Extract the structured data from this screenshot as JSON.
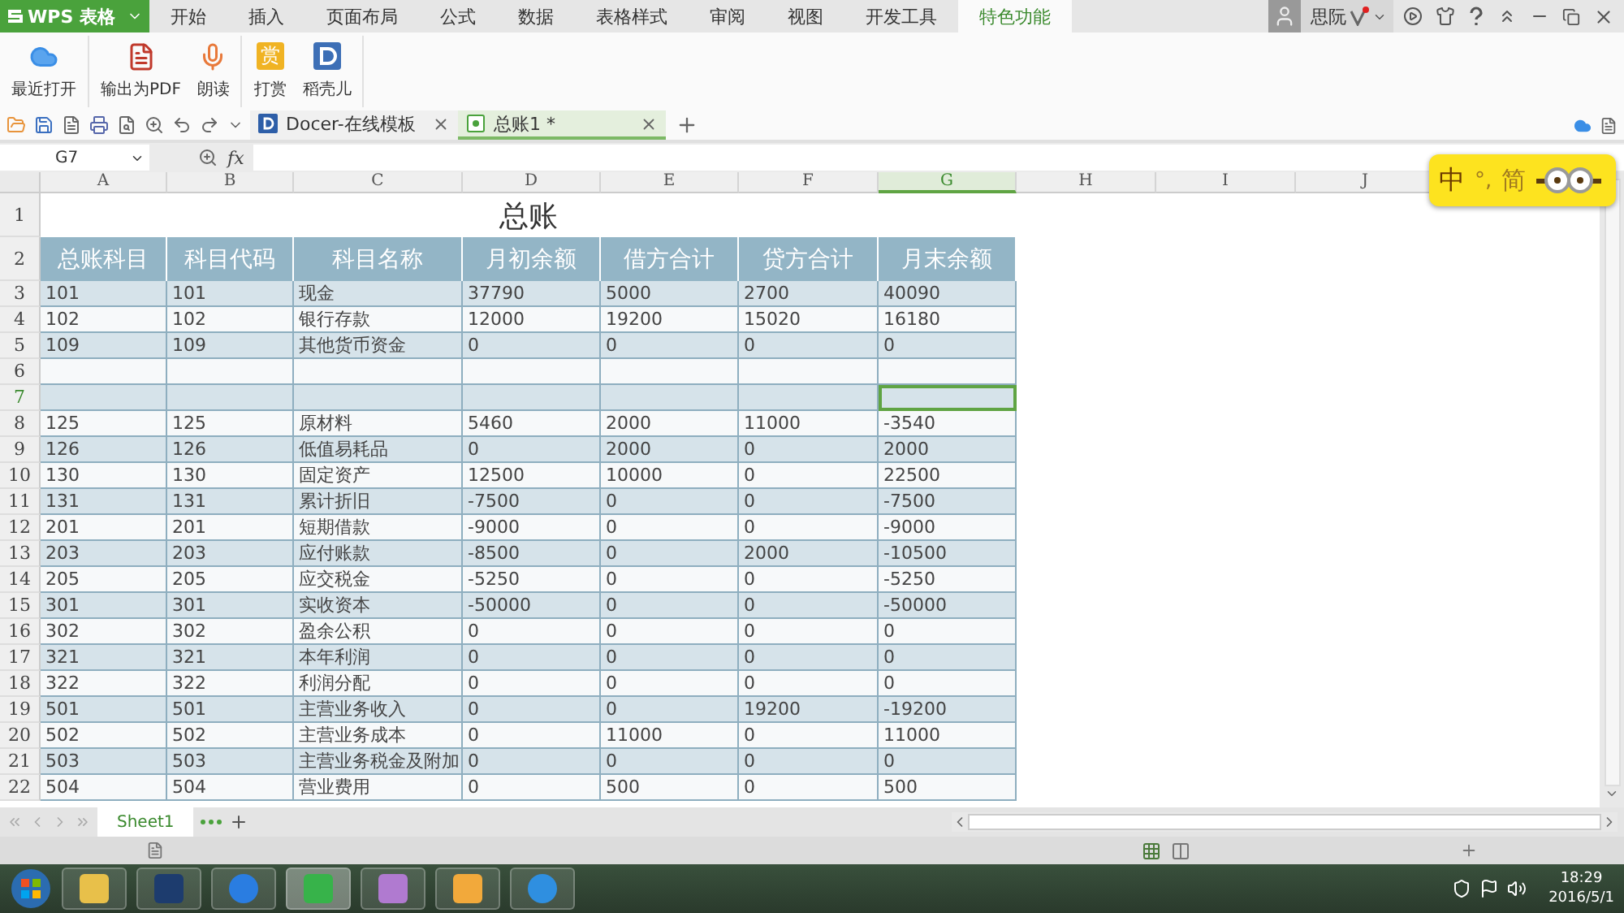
{
  "app_menu": {
    "label": "WPS 表格"
  },
  "ribbon_tabs": [
    {
      "label": "开始",
      "selected": false
    },
    {
      "label": "插入",
      "selected": false
    },
    {
      "label": "页面布局",
      "selected": false
    },
    {
      "label": "公式",
      "selected": false
    },
    {
      "label": "数据",
      "selected": false
    },
    {
      "label": "表格样式",
      "selected": false
    },
    {
      "label": "审阅",
      "selected": false
    },
    {
      "label": "视图",
      "selected": false
    },
    {
      "label": "开发工具",
      "selected": false
    },
    {
      "label": "特色功能",
      "selected": true
    }
  ],
  "user": {
    "name": "思阮"
  },
  "ribbon_groups": [
    [
      {
        "label": "最近打开",
        "kind": "cloud"
      }
    ],
    [
      {
        "label": "输出为PDF",
        "kind": "pdf"
      },
      {
        "label": "朗读",
        "kind": "mic"
      }
    ],
    [
      {
        "label": "打赏",
        "kind": "reward",
        "glyph": "赏"
      },
      {
        "label": "稻壳儿",
        "kind": "shell"
      }
    ]
  ],
  "doc_tabs": [
    {
      "label": "Docer-在线模板",
      "kind": "docer",
      "selected": false
    },
    {
      "label": "总账1 *",
      "kind": "sheet",
      "selected": true
    }
  ],
  "formula_bar": {
    "name_box": "G7",
    "fx_label": "fx"
  },
  "ime": {
    "mode": "中",
    "punct": "°,",
    "script": "简"
  },
  "columns": [
    {
      "label": "A",
      "selected": false
    },
    {
      "label": "B",
      "selected": false
    },
    {
      "label": "C",
      "selected": false
    },
    {
      "label": "D",
      "selected": false
    },
    {
      "label": "E",
      "selected": false
    },
    {
      "label": "F",
      "selected": false
    },
    {
      "label": "G",
      "selected": true
    },
    {
      "label": "H",
      "selected": false
    },
    {
      "label": "I",
      "selected": false
    },
    {
      "label": "J",
      "selected": false
    }
  ],
  "title_row": {
    "num": "1",
    "text": "总账"
  },
  "header_row": {
    "num": "2",
    "cells": [
      "总账科目",
      "科目代码",
      "科目名称",
      "月初余额",
      "借方合计",
      "贷方合计",
      "月末余额"
    ]
  },
  "rows": [
    {
      "num": "3",
      "selected": false,
      "cells": [
        "101",
        "101",
        "现金",
        "37790",
        "5000",
        "2700",
        "40090"
      ]
    },
    {
      "num": "4",
      "selected": false,
      "cells": [
        "102",
        "102",
        "银行存款",
        "12000",
        "19200",
        "15020",
        "16180"
      ]
    },
    {
      "num": "5",
      "selected": false,
      "cells": [
        "109",
        "109",
        "其他货币资金",
        "0",
        "0",
        "0",
        "0"
      ]
    },
    {
      "num": "6",
      "selected": false,
      "cells": []
    },
    {
      "num": "7",
      "selected": true,
      "cells": []
    },
    {
      "num": "8",
      "selected": false,
      "cells": [
        "125",
        "125",
        "原材料",
        "5460",
        "2000",
        "11000",
        "-3540"
      ]
    },
    {
      "num": "9",
      "selected": false,
      "cells": [
        "126",
        "126",
        "低值易耗品",
        "0",
        "2000",
        "0",
        "2000"
      ]
    },
    {
      "num": "10",
      "selected": false,
      "cells": [
        "130",
        "130",
        "固定资产",
        "12500",
        "10000",
        "0",
        "22500"
      ]
    },
    {
      "num": "11",
      "selected": false,
      "cells": [
        "131",
        "131",
        "累计折旧",
        "-7500",
        "0",
        "0",
        "-7500"
      ]
    },
    {
      "num": "12",
      "selected": false,
      "cells": [
        "201",
        "201",
        "短期借款",
        "-9000",
        "0",
        "0",
        "-9000"
      ]
    },
    {
      "num": "13",
      "selected": false,
      "cells": [
        "203",
        "203",
        "应付账款",
        "-8500",
        "0",
        "2000",
        "-10500"
      ]
    },
    {
      "num": "14",
      "selected": false,
      "cells": [
        "205",
        "205",
        "应交税金",
        "-5250",
        "0",
        "0",
        "-5250"
      ]
    },
    {
      "num": "15",
      "selected": false,
      "cells": [
        "301",
        "301",
        "实收资本",
        "-50000",
        "0",
        "0",
        "-50000"
      ]
    },
    {
      "num": "16",
      "selected": false,
      "cells": [
        "302",
        "302",
        "盈余公积",
        "0",
        "0",
        "0",
        "0"
      ]
    },
    {
      "num": "17",
      "selected": false,
      "cells": [
        "321",
        "321",
        "本年利润",
        "0",
        "0",
        "0",
        "0"
      ]
    },
    {
      "num": "18",
      "selected": false,
      "cells": [
        "322",
        "322",
        "利润分配",
        "0",
        "0",
        "0",
        "0"
      ]
    },
    {
      "num": "19",
      "selected": false,
      "cells": [
        "501",
        "501",
        "主营业务收入",
        "0",
        "0",
        "19200",
        "-19200"
      ]
    },
    {
      "num": "20",
      "selected": false,
      "cells": [
        "502",
        "502",
        "主营业务成本",
        "0",
        "11000",
        "0",
        "11000"
      ]
    },
    {
      "num": "21",
      "selected": false,
      "cells": [
        "503",
        "503",
        "主营业务税金及附加",
        "0",
        "0",
        "0",
        "0"
      ]
    },
    {
      "num": "22",
      "selected": false,
      "cells": [
        "504",
        "504",
        "营业费用",
        "0",
        "500",
        "0",
        "500"
      ]
    }
  ],
  "sheets": [
    {
      "label": "Sheet1",
      "selected": true
    }
  ],
  "taskbar": {
    "apps": [
      {
        "kind": "folder",
        "active": false
      },
      {
        "kind": "photoshop",
        "active": false
      },
      {
        "kind": "sogou",
        "active": false
      },
      {
        "kind": "wps",
        "active": true
      },
      {
        "kind": "paint",
        "active": false
      },
      {
        "kind": "notes",
        "active": false
      },
      {
        "kind": "browser",
        "active": false
      }
    ],
    "time": "18:29",
    "date": "2016/5/1"
  }
}
